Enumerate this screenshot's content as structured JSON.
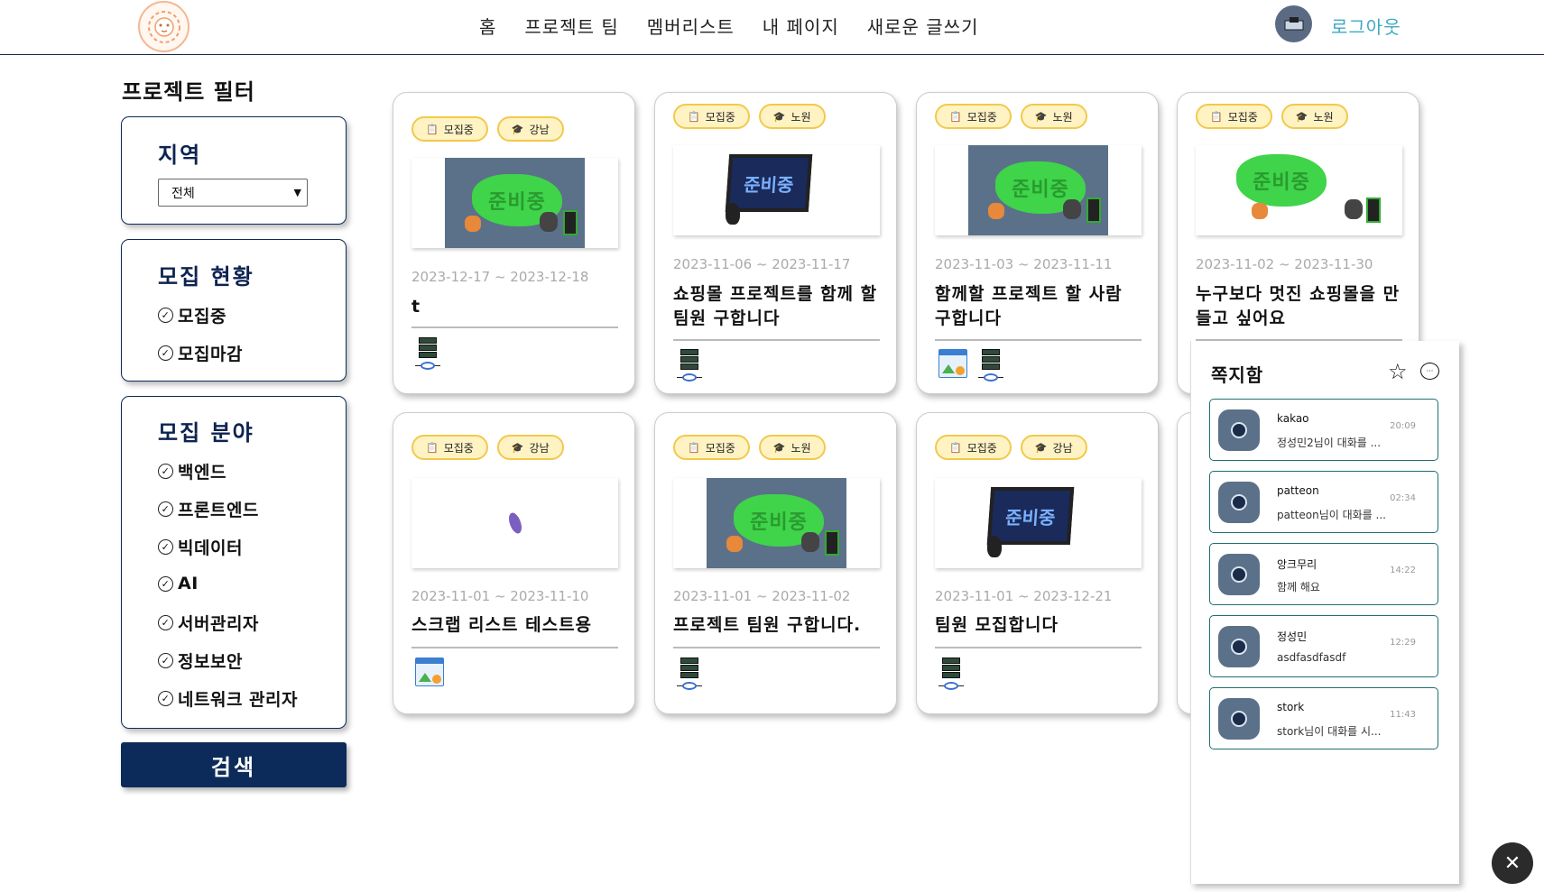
{
  "header": {
    "nav": [
      "홈",
      "프로젝트 팀",
      "멤버리스트",
      "내 페이지",
      "새로운 글쓰기"
    ],
    "logout": "로그아웃"
  },
  "filter": {
    "title": "프로젝트 필터",
    "region": {
      "heading": "지역",
      "selected": "전체"
    },
    "status": {
      "heading": "모집 현황",
      "options": [
        "모집중",
        "모집마감"
      ]
    },
    "fields": {
      "heading": "모집 분야",
      "options": [
        "백엔드",
        "프론트엔드",
        "빅데이터",
        "AI",
        "서버관리자",
        "정보보안",
        "네트워크 관리자"
      ]
    },
    "search_label": "검색"
  },
  "cards": [
    {
      "status": "모집중",
      "region": "강남",
      "dates": "2023-12-17 ~ 2023-12-18",
      "title": "t",
      "stack": [
        "server"
      ]
    },
    {
      "status": "모집중",
      "region": "노원",
      "dates": "2023-11-06 ~ 2023-11-17",
      "title": "쇼핑몰 프로젝트를 함께 할 팀원 구합니다",
      "stack": [
        "server"
      ]
    },
    {
      "status": "모집중",
      "region": "노원",
      "dates": "2023-11-03 ~ 2023-11-11",
      "title": "함께할 프로젝트 할 사람 구합니다",
      "stack": [
        "web",
        "server"
      ]
    },
    {
      "status": "모집중",
      "region": "노원",
      "dates": "2023-11-02 ~ 2023-11-30",
      "title": "누구보다 멋진 쇼핑몰을 만들고 싶어요",
      "stack": []
    },
    {
      "status": "모집중",
      "region": "강남",
      "dates": "2023-11-01 ~ 2023-11-10",
      "title": "스크랩 리스트 테스트용",
      "stack": [
        "web"
      ]
    },
    {
      "status": "모집중",
      "region": "노원",
      "dates": "2023-11-01 ~ 2023-11-02",
      "title": "프로젝트 팀원 구합니다.",
      "stack": [
        "server"
      ]
    },
    {
      "status": "모집중",
      "region": "강남",
      "dates": "2023-11-01 ~ 2023-12-21",
      "title": "팀원 모집합니다",
      "stack": [
        "server"
      ]
    }
  ],
  "thumb_text": "준비중",
  "messages": {
    "title": "쪽지함",
    "items": [
      {
        "name": "kakao",
        "preview": "정성민2님이 대화를 ...",
        "time": "20:09"
      },
      {
        "name": "patteon",
        "preview": "patteon님이 대화를 ...",
        "time": "02:34"
      },
      {
        "name": "앙크무리",
        "preview": "함께 해요",
        "time": "14:22"
      },
      {
        "name": "정성민",
        "preview": "asdfasdfasdf",
        "time": "12:29"
      },
      {
        "name": "stork",
        "preview": "stork님이 대화를 시...",
        "time": "11:43"
      }
    ]
  },
  "icons": {
    "logo": "lion-logo-icon",
    "close": "close-icon",
    "star": "star-icon",
    "chat": "chat-bubble-icon",
    "check": "check-circle-icon"
  },
  "colors": {
    "primary": "#0d2b5a",
    "logout": "#3fa9c4",
    "badge_bg": "#fff3c4",
    "badge_border": "#f2c94c",
    "msg_border": "#1f6f6f"
  }
}
